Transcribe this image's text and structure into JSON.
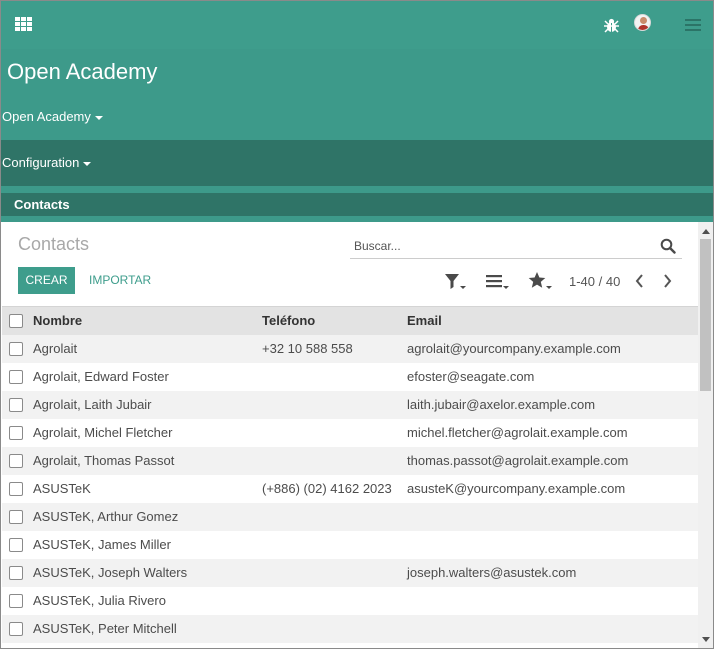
{
  "app": {
    "title": "Open Academy"
  },
  "menus": {
    "open_academy": "Open Academy",
    "configuration": "Configuration",
    "contacts": "Contacts"
  },
  "topbar": {
    "icons": [
      "apps-grid-icon",
      "bug-icon",
      "user-avatar",
      "hamburger-menu-icon"
    ]
  },
  "control": {
    "breadcrumb": "Contacts",
    "search_placeholder": "Buscar...",
    "create_label": "CREAR",
    "import_label": "IMPORTAR",
    "pager": "1-40 / 40"
  },
  "table": {
    "columns": [
      "Nombre",
      "Teléfono",
      "Email"
    ],
    "rows": [
      {
        "name": "Agrolait",
        "phone": "+32 10 588 558",
        "email": "agrolait@yourcompany.example.com"
      },
      {
        "name": "Agrolait, Edward Foster",
        "phone": "",
        "email": "efoster@seagate.com"
      },
      {
        "name": "Agrolait, Laith Jubair",
        "phone": "",
        "email": "laith.jubair@axelor.example.com"
      },
      {
        "name": "Agrolait, Michel Fletcher",
        "phone": "",
        "email": "michel.fletcher@agrolait.example.com"
      },
      {
        "name": "Agrolait, Thomas Passot",
        "phone": "",
        "email": "thomas.passot@agrolait.example.com"
      },
      {
        "name": "ASUSTeK",
        "phone": "(+886) (02) 4162 2023",
        "email": "asusteK@yourcompany.example.com"
      },
      {
        "name": "ASUSTeK, Arthur Gomez",
        "phone": "",
        "email": ""
      },
      {
        "name": "ASUSTeK, James Miller",
        "phone": "",
        "email": ""
      },
      {
        "name": "ASUSTeK, Joseph Walters",
        "phone": "",
        "email": "joseph.walters@asustek.com"
      },
      {
        "name": "ASUSTeK, Julia Rivero",
        "phone": "",
        "email": ""
      },
      {
        "name": "ASUSTeK, Peter Mitchell",
        "phone": "",
        "email": ""
      }
    ]
  },
  "colors": {
    "brand": "#3e9d8c",
    "brand_dark": "#2f7467"
  }
}
